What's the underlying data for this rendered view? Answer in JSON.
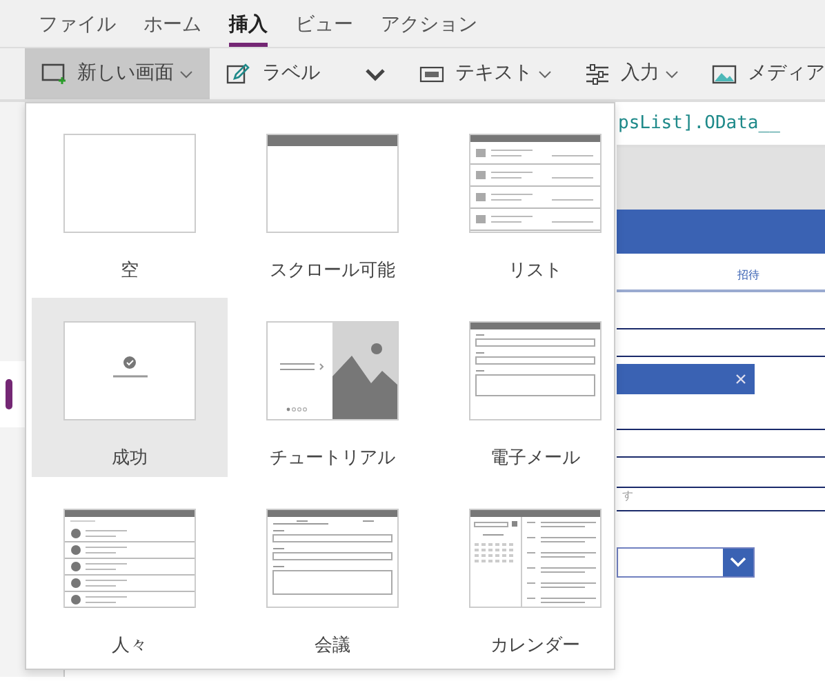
{
  "menu": [
    {
      "label": "ファイル",
      "selected": false
    },
    {
      "label": "ホーム",
      "selected": false
    },
    {
      "label": "挿入",
      "selected": true
    },
    {
      "label": "ビュー",
      "selected": false
    },
    {
      "label": "アクション",
      "selected": false
    }
  ],
  "toolbar": [
    {
      "kind": "new-screen",
      "label": "新しい画面",
      "selected": true,
      "dropdown": true
    },
    {
      "kind": "label",
      "label": "ラベル",
      "selected": false,
      "dropdown": false
    },
    {
      "kind": "more",
      "selected": false
    },
    {
      "kind": "text",
      "label": "テキスト",
      "selected": false,
      "dropdown": true
    },
    {
      "kind": "input",
      "label": "入力",
      "selected": false,
      "dropdown": true
    },
    {
      "kind": "media",
      "label": "メディア",
      "selected": false,
      "dropdown": false
    }
  ],
  "formula": "psList].OData__",
  "screen_templates": [
    {
      "kind": "blank",
      "label": "空",
      "selected": false
    },
    {
      "kind": "scrollable",
      "label": "スクロール可能",
      "selected": false
    },
    {
      "kind": "list",
      "label": "リスト",
      "selected": false
    },
    {
      "kind": "success",
      "label": "成功",
      "selected": true
    },
    {
      "kind": "tutorial",
      "label": "チュートリアル",
      "selected": false
    },
    {
      "kind": "email",
      "label": "電子メール",
      "selected": false
    },
    {
      "kind": "people",
      "label": "人々",
      "selected": false
    },
    {
      "kind": "meeting",
      "label": "会議",
      "selected": false
    },
    {
      "kind": "calendar",
      "label": "カレンダー",
      "selected": false
    }
  ],
  "canvas": {
    "tab_label": "招待",
    "hint": "す"
  }
}
